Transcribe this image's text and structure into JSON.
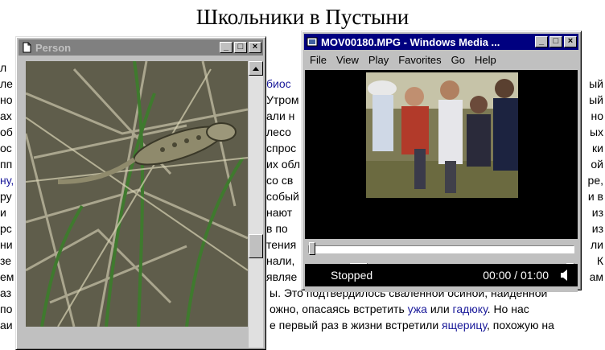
{
  "page_title": "Школьники в Пустыни",
  "background_text": [
    {
      "t": "л"
    },
    {
      "t": "ле",
      "r": "биос",
      "r_link": true,
      "r2": "ый"
    },
    {
      "t": "но",
      "r": "Утром",
      "r2": "ый"
    },
    {
      "t": "ах",
      "r": "али н",
      "r2": "но"
    },
    {
      "t": "об",
      "r": "лесо",
      "r2": "ых"
    },
    {
      "t": "ос",
      "r": "спрос",
      "r2": "ки"
    },
    {
      "t": "пп",
      "r": "их обл",
      "r2": "ой"
    },
    {
      "t": "ну,",
      "t_link": true,
      "r": "со св",
      "r2": "ре,"
    },
    {
      "t": "ру",
      "r": "собый",
      "r2": "и в"
    },
    {
      "t": "и",
      "r": "нают",
      "r2": "из"
    },
    {
      "t": "рс",
      "r": "в по",
      "r2": "из"
    },
    {
      "t": "ни",
      "r": "тения",
      "r2": "ли"
    },
    {
      "t": "зе",
      "r": "нали,",
      "r2": "К"
    },
    {
      "t": "ем",
      "r": "являе",
      "r2": "ам"
    },
    {
      "t": "аз",
      "r": "ы. Это подтвердилось сваленной осиной, найденной"
    },
    {
      "t": "по",
      "r": "ожно, опасаясь встретить ",
      "rl1": "ужа",
      "rm": " или ",
      "rl2": "гадюку",
      "re": ". Но нас"
    },
    {
      "t": "аи",
      "r": "е первый раз в жизни встретили ",
      "rl1": "ящерицу",
      "re": ", похожую на"
    }
  ],
  "windows": {
    "person": {
      "title": "Person",
      "active": false,
      "buttons": {
        "minimize": "_",
        "maximize": "□",
        "close": "×"
      }
    },
    "media_player": {
      "title": "MOV00180.MPG - Windows Media ...",
      "active": true,
      "buttons": {
        "minimize": "_",
        "maximize": "□",
        "close": "×"
      },
      "menu": [
        "File",
        "View",
        "Play",
        "Favorites",
        "Go",
        "Help"
      ],
      "status": "Stopped",
      "time": "00:00 / 01:00",
      "seek_progress": 0.0,
      "volume_level": 0.9,
      "controls": [
        "play-icon",
        "pause-icon",
        "stop-icon",
        "skip-back-icon",
        "rewind-icon",
        "fast-forward-icon",
        "skip-forward-icon",
        "playlist-icon",
        "speaker-icon"
      ]
    }
  },
  "colors": {
    "active_title": "#000080",
    "inactive_title": "#808080",
    "link": "#1a1a9a",
    "window_face": "#c0c0c0"
  }
}
